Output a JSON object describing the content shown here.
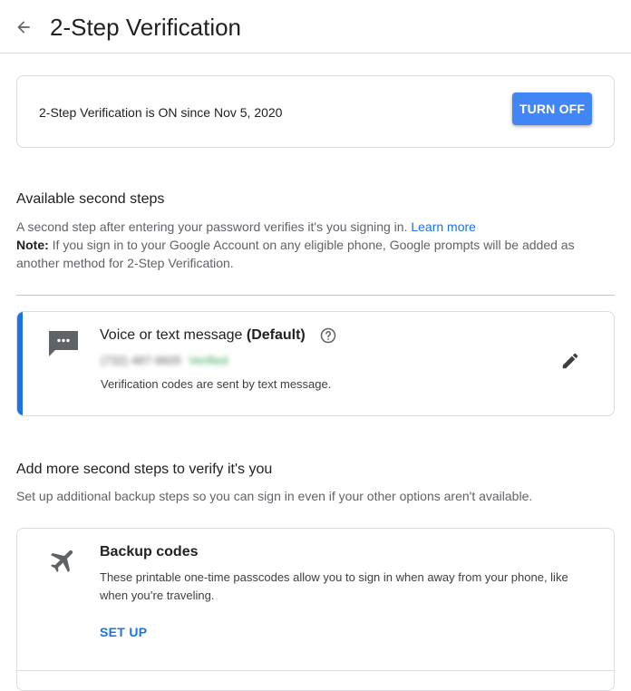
{
  "header": {
    "title": "2-Step Verification",
    "back_icon": "arrow-back-icon"
  },
  "status": {
    "text": "2-Step Verification is ON since Nov 5, 2020",
    "turn_off_label": "TURN OFF",
    "button_color": "#4285f4"
  },
  "available": {
    "title": "Available second steps",
    "desc": "A second step after entering your password verifies it's you signing in.",
    "learn_more": "Learn more",
    "note_label": "Note:",
    "note_text": "If you sign in to your Google Account on any eligible phone, Google prompts will be added as another method for 2-Step Verification."
  },
  "voice_method": {
    "icon": "message-icon",
    "title": "Voice or text message",
    "default_label": "(Default)",
    "help_icon": "help-icon",
    "phone": "(732) 487-9605",
    "verified": "Verified",
    "desc": "Verification codes are sent by text message.",
    "edit_icon": "edit-icon",
    "accent_color": "#1a73e8"
  },
  "add_more": {
    "title": "Add more second steps to verify it's you",
    "desc": "Set up additional backup steps so you can sign in even if your other options aren't available."
  },
  "backup_codes": {
    "icon": "airplane-icon",
    "title": "Backup codes",
    "desc": "These printable one-time passcodes allow you to sign in when away from your phone, like when you’re traveling.",
    "setup_label": "SET UP"
  }
}
